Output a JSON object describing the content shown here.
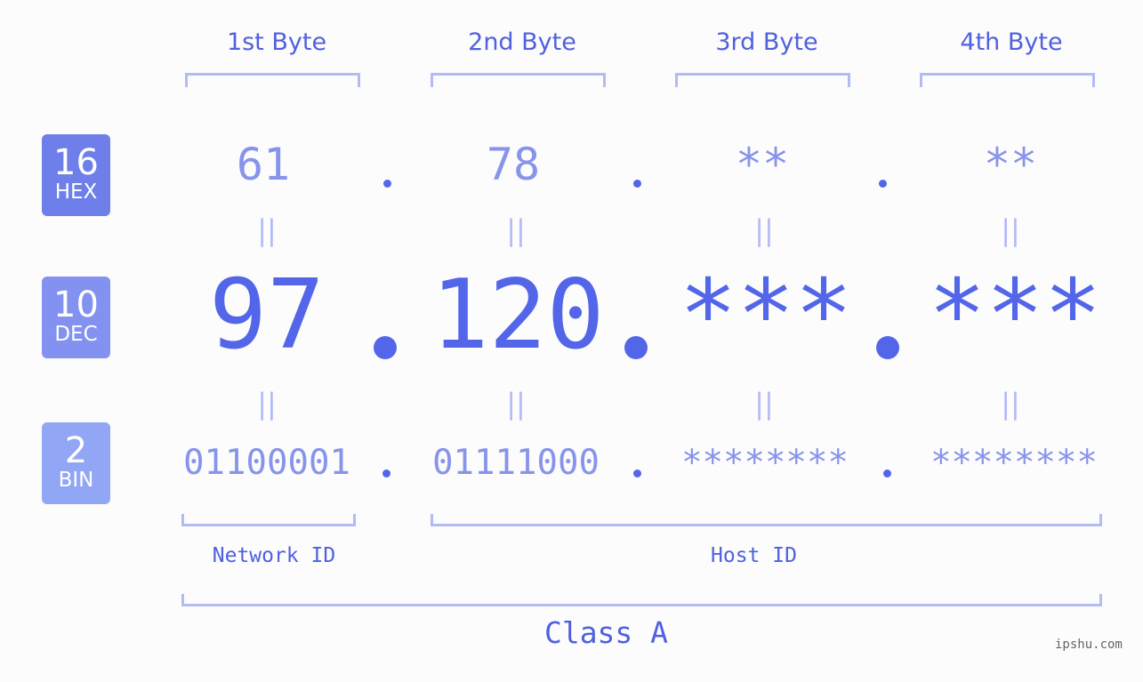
{
  "headers": [
    "1st Byte",
    "2nd Byte",
    "3rd Byte",
    "4th Byte"
  ],
  "badges": {
    "hex": {
      "num": "16",
      "label": "HEX",
      "color": "#6f7fe9"
    },
    "dec": {
      "num": "10",
      "label": "DEC",
      "color": "#8392f0"
    },
    "bin": {
      "num": "2",
      "label": "BIN",
      "color": "#92a6f6"
    }
  },
  "hex": [
    "61",
    "78",
    "**",
    "**"
  ],
  "dec": [
    "97",
    "120",
    "***",
    "***"
  ],
  "bin": [
    "01100001",
    "01111000",
    "********",
    "********"
  ],
  "equals": "||",
  "network_id": "Network ID",
  "host_id": "Host ID",
  "class_label": "Class A",
  "watermark": "ipshu.com",
  "colors": {
    "accent": "#5366ea",
    "light": "#8893ec",
    "bracket": "#b3bbf5"
  }
}
